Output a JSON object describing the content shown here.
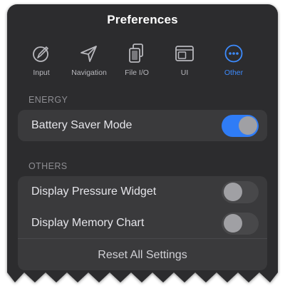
{
  "panel": {
    "title": "Preferences"
  },
  "tabs": [
    {
      "label": "Input",
      "icon": "input-icon",
      "active": false
    },
    {
      "label": "Navigation",
      "icon": "navigation-arrow-icon",
      "active": false
    },
    {
      "label": "File I/O",
      "icon": "documents-icon",
      "active": false
    },
    {
      "label": "UI",
      "icon": "layout-window-icon",
      "active": false
    },
    {
      "label": "Other",
      "icon": "more-ellipsis-circle-icon",
      "active": true
    }
  ],
  "energy": {
    "header": "ENERGY",
    "battery_saver_label": "Battery Saver Mode",
    "battery_saver_on": true
  },
  "others": {
    "header": "OTHERS",
    "pressure_widget_label": "Display Pressure Widget",
    "pressure_widget_on": false,
    "memory_chart_label": "Display Memory Chart",
    "memory_chart_on": false,
    "reset_label": "Reset All Settings"
  },
  "colors": {
    "panel_bg": "#2c2c2e",
    "group_bg": "#3a3a3c",
    "accent": "#2f7cf6",
    "active_tab": "#3d8bfd",
    "inactive_icon": "#b8b8bd"
  }
}
